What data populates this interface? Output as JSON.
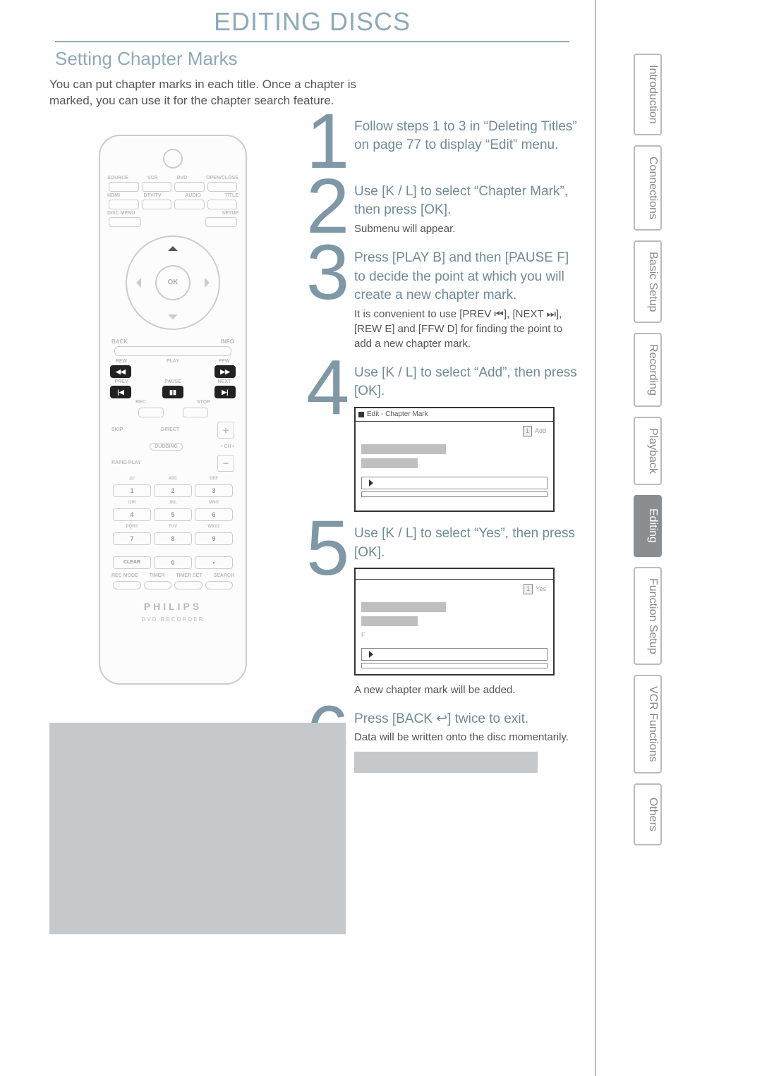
{
  "page_title": "EDITING DISCS",
  "section_title": "Setting Chapter Marks",
  "intro_text": "You can put chapter marks in each title. Once a chapter is marked, you can use it for the chapter search feature.",
  "steps": {
    "s1": {
      "num": "1",
      "lead": "Follow steps 1 to 3 in “Deleting Titles” on page 77 to display “Edit” menu."
    },
    "s2": {
      "num": "2",
      "lead": "Use [K / L] to select “Chapter Mark”, then press [OK].",
      "note": "Submenu will appear."
    },
    "s3": {
      "num": "3",
      "lead": "Press [PLAY B] and then [PAUSE F] to decide the point at which you will create a new chapter mark.",
      "note": "It is convenient to use [PREV ⏮], [NEXT ⏭], [REW E] and [FFW D] for finding the point to add a new chapter mark."
    },
    "s4": {
      "num": "4",
      "lead": "Use [K / L] to select “Add”, then press [OK].",
      "screen_title": "Edit - Chapter Mark",
      "screen_option": "Add",
      "screen_index": "1"
    },
    "s5": {
      "num": "5",
      "lead": "Use [K / L] to select “Yes”, then press [OK].",
      "screen_option": "Yes",
      "screen_index": "1",
      "after": "A new chapter mark will be added."
    },
    "s6": {
      "num": "6",
      "lead": "Press [BACK ↩] twice to exit.",
      "note": "Data will be written onto the disc momentarily."
    }
  },
  "remote": {
    "brand": "PHILIPS",
    "model": "DVD RECORDER",
    "row1": [
      "SOURCE",
      "VCR",
      "DVD",
      "OPEN/CLOSE"
    ],
    "row2": [
      "HDMI",
      "DTV/TV",
      "AUDIO",
      "TITLE"
    ],
    "row3": [
      "DISC MENU",
      "",
      "",
      "SETUP"
    ],
    "ok": "OK",
    "back": "BACK",
    "info": "INFO",
    "rew": "REW",
    "play": "PLAY",
    "ffw": "FFW",
    "prev": "PREV",
    "pause": "PAUSE",
    "next": "NEXT",
    "rec": "REC",
    "stop": "STOP",
    "skip": "SKIP",
    "direct": "DIRECT",
    "dubbing": "DUBBING",
    "rapid": "RAPID PLAY",
    "ch": "• CH •",
    "numlabels": [
      "@/",
      "ABC",
      "DEF",
      "GHI",
      "JKL",
      "MNO",
      "PQRS",
      "TUV",
      "WXYZ",
      "",
      "",
      ""
    ],
    "nums": [
      "1",
      "2",
      "3",
      "4",
      "5",
      "6",
      "7",
      "8",
      "9",
      "CLEAR",
      "0",
      "•"
    ],
    "modes": [
      "REC MODE",
      "TIMER",
      "TIMER SET",
      "SEARCH"
    ]
  },
  "tabs": [
    "Introduction",
    "Connections",
    "Basic Setup",
    "Recording",
    "Playback",
    "Editing",
    "Function Setup",
    "VCR Functions",
    "Others"
  ],
  "active_tab": "Editing"
}
